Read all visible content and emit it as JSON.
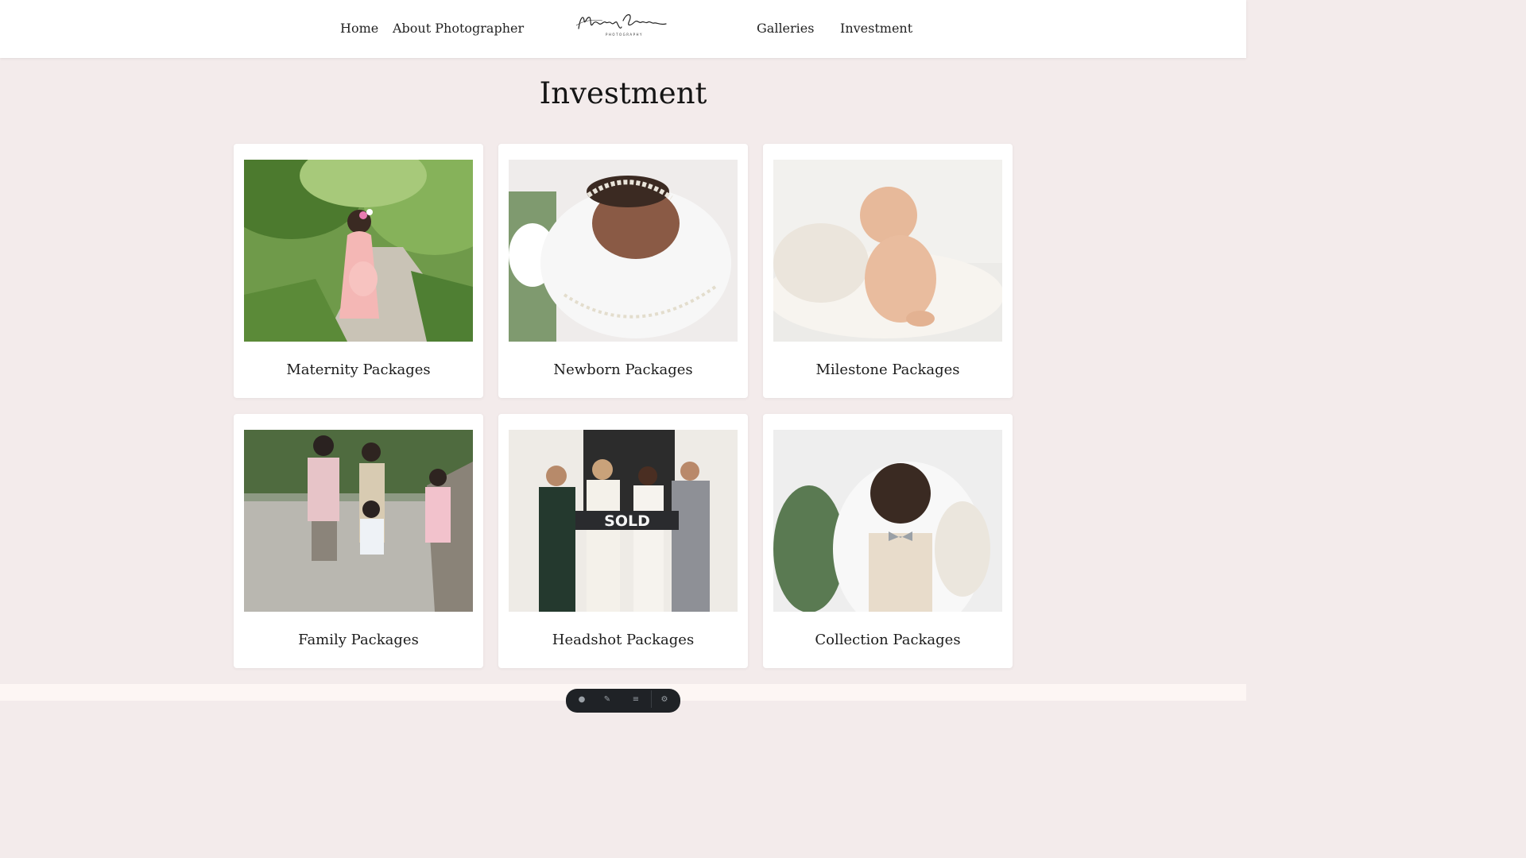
{
  "nav": {
    "home": "Home",
    "about": "About Photographer",
    "galleries": "Galleries",
    "investment": "Investment"
  },
  "logo": {
    "script": "Magnolia Coasts",
    "sub": "PHOTOGRAPHY"
  },
  "page": {
    "title": "Investment"
  },
  "packages": [
    {
      "label": "Maternity Packages",
      "icon": "maternity-photo"
    },
    {
      "label": "Newborn Packages",
      "icon": "newborn-photo"
    },
    {
      "label": "Milestone Packages",
      "icon": "milestone-photo"
    },
    {
      "label": "Family Packages",
      "icon": "family-photo"
    },
    {
      "label": "Headshot Packages",
      "icon": "headshot-photo"
    },
    {
      "label": "Collection Packages",
      "icon": "collection-photo"
    }
  ],
  "photo_text": {
    "sold_sign": "SOLD"
  },
  "colors": {
    "page_background": "#f3ebeb",
    "card_background": "#ffffff",
    "header_background": "#ffffff",
    "text": "#1c1c1c"
  }
}
